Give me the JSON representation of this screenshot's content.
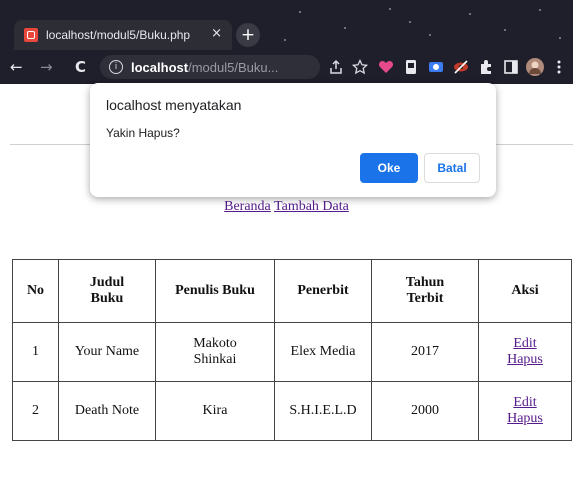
{
  "browser": {
    "tab_title": "localhost/modul5/Buku.php",
    "tab_close": "×",
    "new_tab": "+",
    "back": "←",
    "forward": "→",
    "reload": "C",
    "url_host": "localhost",
    "url_path": "/modul5/Buku...",
    "info_glyph": "i"
  },
  "dialog": {
    "title": "localhost menyatakan",
    "message": "Yakin Hapus?",
    "ok_label": "Oke",
    "cancel_label": "Batal"
  },
  "page": {
    "links": {
      "home": "Beranda",
      "add": "Tambah Data"
    },
    "table": {
      "headers": {
        "no": "No",
        "title_line1": "Judul",
        "title_line2": "Buku",
        "author": "Penulis Buku",
        "publisher": "Penerbit",
        "year_line1": "Tahun",
        "year_line2": "Terbit",
        "action": "Aksi"
      },
      "rows": [
        {
          "no": "1",
          "title": "Your Name",
          "author_line1": "Makoto",
          "author_line2": "Shinkai",
          "publisher": "Elex Media",
          "year": "2017",
          "edit": "Edit",
          "delete": "Hapus"
        },
        {
          "no": "2",
          "title": "Death Note",
          "author_line1": "Kira",
          "author_line2": "",
          "publisher": "S.H.I.E.L.D",
          "year": "2000",
          "edit": "Edit",
          "delete": "Hapus"
        }
      ]
    }
  },
  "colors": {
    "chrome_bg": "#1f1f2b",
    "accent": "#1a73e8",
    "visited_link": "#551a8b"
  }
}
